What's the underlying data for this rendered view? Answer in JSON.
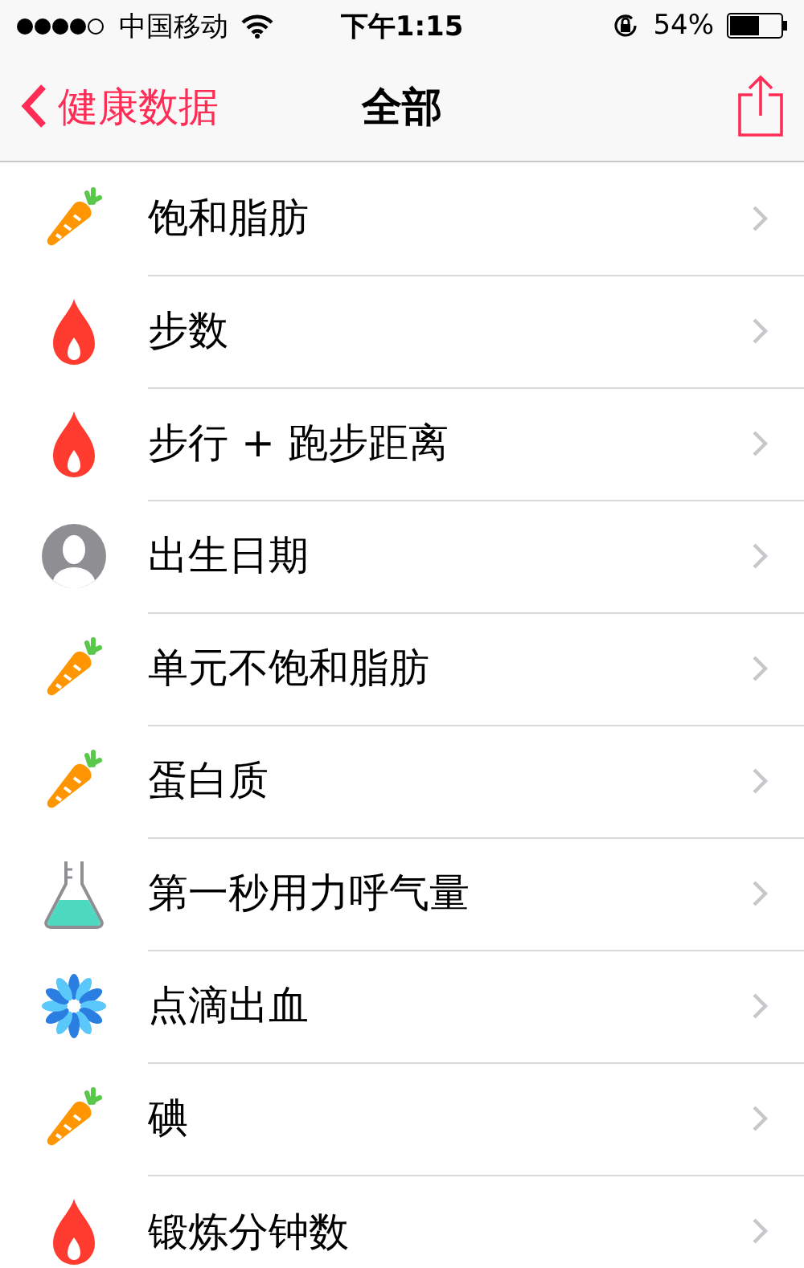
{
  "status_bar": {
    "carrier": "中国移动",
    "time": "下午1:15",
    "battery": "54%"
  },
  "nav": {
    "back": "健康数据",
    "title": "全部"
  },
  "items": [
    {
      "label": "饱和脂肪",
      "kind": "carrot"
    },
    {
      "label": "步数",
      "kind": "flame"
    },
    {
      "label": "步行 + 跑步距离",
      "kind": "flame"
    },
    {
      "label": "出生日期",
      "kind": "person"
    },
    {
      "label": "单元不饱和脂肪",
      "kind": "carrot"
    },
    {
      "label": "蛋白质",
      "kind": "carrot"
    },
    {
      "label": "第一秒用力呼气量",
      "kind": "flask"
    },
    {
      "label": "点滴出血",
      "kind": "flower"
    },
    {
      "label": "碘",
      "kind": "carrot"
    },
    {
      "label": "锻炼分钟数",
      "kind": "flame"
    }
  ]
}
